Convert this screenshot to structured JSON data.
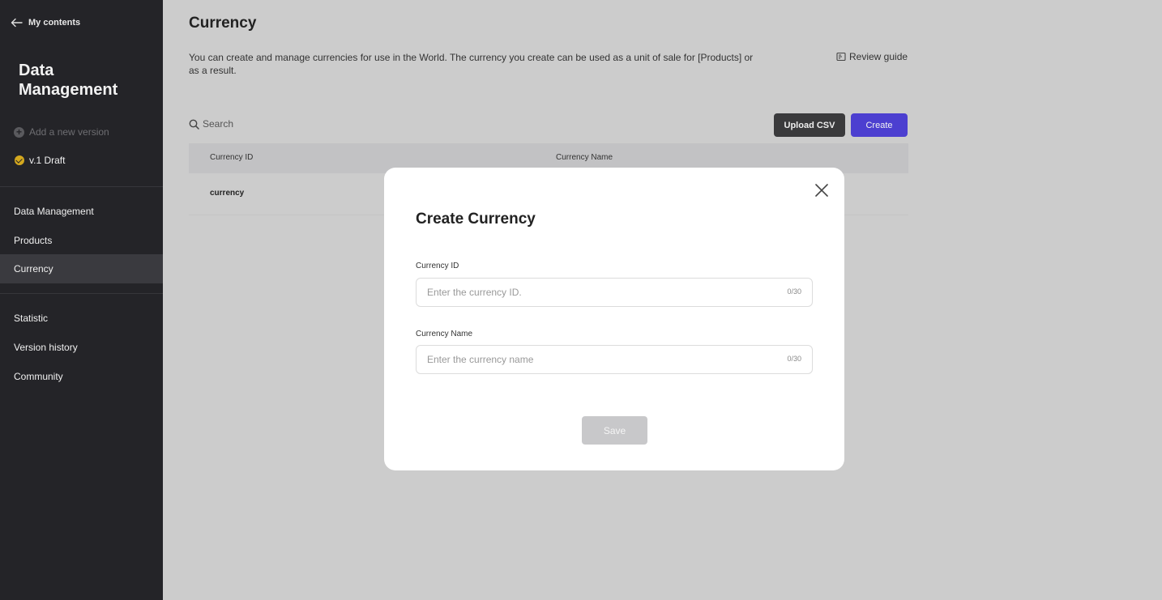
{
  "sidebar": {
    "back_label": "My contents",
    "title": "Data Management",
    "add_version": "Add a new version",
    "draft": "v.1 Draft",
    "nav": [
      {
        "label": "Data Management"
      },
      {
        "label": "Products"
      },
      {
        "label": "Currency",
        "active": true
      },
      {
        "label": "Statistic"
      },
      {
        "label": "Version history"
      },
      {
        "label": "Community"
      }
    ]
  },
  "main": {
    "title": "Currency",
    "description": "You can create and manage currencies for use in the World. The currency you create can be used as a unit of sale for [Products] or as a result.",
    "review_guide": "Review guide",
    "search_placeholder": "Search",
    "upload_csv": "Upload CSV",
    "create": "Create",
    "table": {
      "headers": [
        "Currency ID",
        "Currency Name"
      ],
      "rows": [
        [
          "currency",
          ""
        ]
      ]
    }
  },
  "modal": {
    "title": "Create Currency",
    "fields": [
      {
        "label": "Currency ID",
        "placeholder": "Enter the currency ID.",
        "value": "",
        "counter": "0/30"
      },
      {
        "label": "Currency Name",
        "placeholder": "Enter the currency name",
        "value": "",
        "counter": "0/30"
      }
    ],
    "save": "Save"
  },
  "colors": {
    "sidebar_bg": "#242428",
    "accent": "#4c3fd0",
    "draft_badge": "#d4a81e",
    "overlay": "#cccccc"
  },
  "icons": {
    "back": "arrow-left-icon",
    "add_version": "plus-circle-icon",
    "draft": "check-circle-icon",
    "review_guide": "book-icon",
    "search": "search-icon",
    "close": "close-icon"
  }
}
